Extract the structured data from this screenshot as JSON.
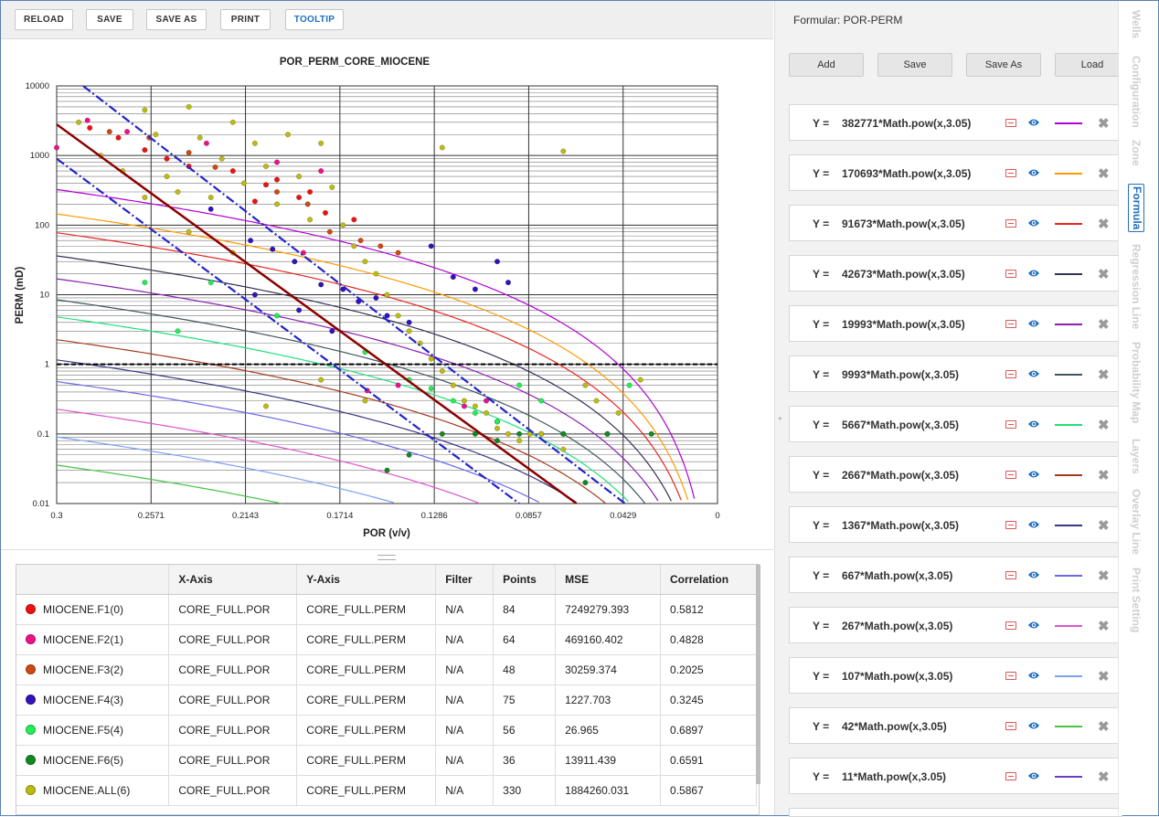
{
  "toolbar": {
    "reload": "RELOAD",
    "save": "SAVE",
    "save_as": "SAVE AS",
    "print": "PRINT",
    "tooltip": "TOOLTIP"
  },
  "chart_data": {
    "type": "scatter",
    "title": "POR_PERM_CORE_MIOCENE",
    "xlabel": "POR (v/v)",
    "ylabel": "PERM (mD)",
    "x_scale": "linear-reversed",
    "y_scale": "log",
    "xlim": [
      0.3,
      0
    ],
    "ylim": [
      0.01,
      10000
    ],
    "grid": true,
    "x_ticks": [
      "0.3",
      "0.2571",
      "0.2143",
      "0.1714",
      "0.1286",
      "0.0857",
      "0.0429",
      "0"
    ],
    "y_ticks": [
      "10000",
      "1000",
      "100",
      "10",
      "1",
      "0.1",
      "0.01"
    ],
    "cutoff_line": {
      "y": 1,
      "style": "dashed",
      "color": "#000000"
    },
    "regression_lines": [
      {
        "style": "solid",
        "color": "#8b0000",
        "points": [
          [
            0.3,
            2800
          ],
          [
            0.064,
            0.01
          ]
        ]
      },
      {
        "style": "dash-dot",
        "color": "#2222cc",
        "points": [
          [
            0.288,
            10000
          ],
          [
            0.042,
            0.01
          ]
        ]
      },
      {
        "style": "dash-dot",
        "color": "#2222cc",
        "points": [
          [
            0.3,
            900
          ],
          [
            0.09,
            0.01
          ]
        ]
      }
    ],
    "formula_curves": [
      {
        "coef": 382771,
        "color": "#b300d6"
      },
      {
        "coef": 170693,
        "color": "#ff9900"
      },
      {
        "coef": 91673,
        "color": "#e8251f"
      },
      {
        "coef": 42673,
        "color": "#333355"
      },
      {
        "coef": 19993,
        "color": "#8a1fb0"
      },
      {
        "coef": 9993,
        "color": "#40565c"
      },
      {
        "coef": 5667,
        "color": "#1fe07a"
      },
      {
        "coef": 2667,
        "color": "#a33b1d"
      },
      {
        "coef": 1367,
        "color": "#373785"
      },
      {
        "coef": 667,
        "color": "#6a6ae8"
      },
      {
        "coef": 267,
        "color": "#dd55cc"
      },
      {
        "coef": 107,
        "color": "#7aa3f5"
      },
      {
        "coef": 42,
        "color": "#47c447"
      },
      {
        "coef": 11,
        "color": "#6a3fc4"
      }
    ],
    "series": [
      {
        "name": "MIOCENE.F1(0)",
        "color": "#ee1111",
        "points": [
          [
            0.285,
            2500
          ],
          [
            0.272,
            1800
          ],
          [
            0.25,
            900
          ],
          [
            0.22,
            600
          ],
          [
            0.205,
            380
          ],
          [
            0.19,
            250
          ],
          [
            0.178,
            150
          ],
          [
            0.165,
            120
          ],
          [
            0.21,
            220
          ],
          [
            0.24,
            700
          ],
          [
            0.26,
            1200
          ],
          [
            0.2,
            450
          ],
          [
            0.185,
            300
          ]
        ]
      },
      {
        "name": "MIOCENE.F2(1)",
        "color": "#ee1189",
        "points": [
          [
            0.3,
            1300
          ],
          [
            0.286,
            3200
          ],
          [
            0.268,
            2200
          ],
          [
            0.232,
            1500
          ],
          [
            0.2,
            800
          ],
          [
            0.18,
            600
          ],
          [
            0.188,
            40
          ],
          [
            0.159,
            0.42
          ],
          [
            0.145,
            0.5
          ],
          [
            0.115,
            0.25
          ],
          [
            0.105,
            0.3
          ],
          [
            0.1,
            0.15
          ]
        ]
      },
      {
        "name": "MIOCENE.F3(2)",
        "color": "#cc4a11",
        "points": [
          [
            0.276,
            2200
          ],
          [
            0.258,
            1800
          ],
          [
            0.24,
            1100
          ],
          [
            0.228,
            680
          ],
          [
            0.2,
            300
          ],
          [
            0.186,
            200
          ],
          [
            0.176,
            80
          ],
          [
            0.162,
            60
          ],
          [
            0.153,
            50
          ],
          [
            0.145,
            40
          ]
        ]
      },
      {
        "name": "MIOCENE.F4(3)",
        "color": "#3311bb",
        "points": [
          [
            0.23,
            170
          ],
          [
            0.212,
            60
          ],
          [
            0.202,
            45
          ],
          [
            0.192,
            30
          ],
          [
            0.18,
            14
          ],
          [
            0.17,
            12
          ],
          [
            0.163,
            8
          ],
          [
            0.15,
            5
          ],
          [
            0.14,
            4
          ],
          [
            0.13,
            50
          ],
          [
            0.12,
            18
          ],
          [
            0.11,
            12
          ],
          [
            0.1,
            30
          ],
          [
            0.095,
            15
          ],
          [
            0.19,
            6
          ],
          [
            0.175,
            3
          ],
          [
            0.21,
            10
          ],
          [
            0.155,
            9
          ]
        ]
      },
      {
        "name": "MIOCENE.F5(4)",
        "color": "#22ee55",
        "points": [
          [
            0.26,
            15
          ],
          [
            0.245,
            3
          ],
          [
            0.23,
            15
          ],
          [
            0.2,
            5
          ],
          [
            0.16,
            1.5
          ],
          [
            0.14,
            0.6
          ],
          [
            0.13,
            0.45
          ],
          [
            0.12,
            0.3
          ],
          [
            0.11,
            0.2
          ],
          [
            0.1,
            0.15
          ],
          [
            0.09,
            0.5
          ],
          [
            0.08,
            0.3
          ],
          [
            0.07,
            0.1
          ],
          [
            0.05,
            0.1
          ],
          [
            0.04,
            0.5
          ]
        ]
      },
      {
        "name": "MIOCENE.F6(5)",
        "color": "#118822",
        "points": [
          [
            0.14,
            0.05
          ],
          [
            0.125,
            0.1
          ],
          [
            0.11,
            0.1
          ],
          [
            0.1,
            0.08
          ],
          [
            0.09,
            0.1
          ],
          [
            0.08,
            0.1
          ],
          [
            0.07,
            0.1
          ],
          [
            0.05,
            0.1
          ],
          [
            0.03,
            0.1
          ],
          [
            0.15,
            0.03
          ],
          [
            0.06,
            0.02
          ]
        ]
      },
      {
        "name": "MIOCENE.ALL(6)",
        "color": "#bbbb11",
        "points": [
          [
            0.29,
            3000
          ],
          [
            0.28,
            1000
          ],
          [
            0.27,
            600
          ],
          [
            0.26,
            4500
          ],
          [
            0.255,
            2000
          ],
          [
            0.25,
            500
          ],
          [
            0.245,
            300
          ],
          [
            0.24,
            5000
          ],
          [
            0.235,
            1800
          ],
          [
            0.23,
            250
          ],
          [
            0.225,
            900
          ],
          [
            0.22,
            3000
          ],
          [
            0.215,
            400
          ],
          [
            0.21,
            1500
          ],
          [
            0.205,
            700
          ],
          [
            0.2,
            200
          ],
          [
            0.195,
            2000
          ],
          [
            0.19,
            500
          ],
          [
            0.185,
            120
          ],
          [
            0.18,
            1500
          ],
          [
            0.175,
            350
          ],
          [
            0.17,
            100
          ],
          [
            0.165,
            50
          ],
          [
            0.16,
            30
          ],
          [
            0.155,
            20
          ],
          [
            0.15,
            10
          ],
          [
            0.145,
            5
          ],
          [
            0.14,
            3
          ],
          [
            0.135,
            2
          ],
          [
            0.13,
            1.2
          ],
          [
            0.125,
            0.8
          ],
          [
            0.12,
            0.5
          ],
          [
            0.115,
            0.3
          ],
          [
            0.11,
            0.25
          ],
          [
            0.105,
            0.2
          ],
          [
            0.1,
            0.12
          ],
          [
            0.095,
            0.1
          ],
          [
            0.09,
            0.08
          ],
          [
            0.085,
            0.1
          ],
          [
            0.08,
            0.1
          ],
          [
            0.07,
            0.06
          ],
          [
            0.06,
            0.5
          ],
          [
            0.055,
            0.3
          ],
          [
            0.045,
            0.2
          ],
          [
            0.035,
            0.6
          ],
          [
            0.125,
            1300
          ],
          [
            0.07,
            1150
          ],
          [
            0.205,
            0.25
          ],
          [
            0.18,
            0.6
          ],
          [
            0.16,
            0.3
          ],
          [
            0.26,
            250
          ],
          [
            0.24,
            80
          ],
          [
            0.22,
            40
          ]
        ]
      }
    ]
  },
  "table": {
    "headers": [
      "",
      "X-Axis",
      "Y-Axis",
      "Filter",
      "Points",
      "MSE",
      "Correlation"
    ],
    "rows": [
      {
        "color": "#ee1111",
        "name": "MIOCENE.F1(0)",
        "x": "CORE_FULL.POR",
        "y": "CORE_FULL.PERM",
        "filter": "N/A",
        "points": "84",
        "mse": "7249279.393",
        "corr": "0.5812"
      },
      {
        "color": "#ee1189",
        "name": "MIOCENE.F2(1)",
        "x": "CORE_FULL.POR",
        "y": "CORE_FULL.PERM",
        "filter": "N/A",
        "points": "64",
        "mse": "469160.402",
        "corr": "0.4828"
      },
      {
        "color": "#cc4a11",
        "name": "MIOCENE.F3(2)",
        "x": "CORE_FULL.POR",
        "y": "CORE_FULL.PERM",
        "filter": "N/A",
        "points": "48",
        "mse": "30259.374",
        "corr": "0.2025"
      },
      {
        "color": "#3311bb",
        "name": "MIOCENE.F4(3)",
        "x": "CORE_FULL.POR",
        "y": "CORE_FULL.PERM",
        "filter": "N/A",
        "points": "75",
        "mse": "1227.703",
        "corr": "0.3245"
      },
      {
        "color": "#22ee55",
        "name": "MIOCENE.F5(4)",
        "x": "CORE_FULL.POR",
        "y": "CORE_FULL.PERM",
        "filter": "N/A",
        "points": "56",
        "mse": "26.965",
        "corr": "0.6897"
      },
      {
        "color": "#118822",
        "name": "MIOCENE.F6(5)",
        "x": "CORE_FULL.POR",
        "y": "CORE_FULL.PERM",
        "filter": "N/A",
        "points": "36",
        "mse": "13911.439",
        "corr": "0.6591"
      },
      {
        "color": "#bbbb11",
        "name": "MIOCENE.ALL(6)",
        "x": "CORE_FULL.POR",
        "y": "CORE_FULL.PERM",
        "filter": "N/A",
        "points": "330",
        "mse": "1884260.031",
        "corr": "0.5867"
      }
    ]
  },
  "formula_panel": {
    "title": "Formular: POR-PERM",
    "buttons": [
      "Add",
      "Save",
      "Save As",
      "Load"
    ],
    "y_label": "Y =",
    "formulas": [
      {
        "text": "382771*Math.pow(x,3.05)",
        "color": "#b300d6"
      },
      {
        "text": "170693*Math.pow(x,3.05)",
        "color": "#ff9900"
      },
      {
        "text": "91673*Math.pow(x,3.05)",
        "color": "#e8251f"
      },
      {
        "text": "42673*Math.pow(x,3.05)",
        "color": "#333355"
      },
      {
        "text": "19993*Math.pow(x,3.05)",
        "color": "#8a1fb0"
      },
      {
        "text": "9993*Math.pow(x,3.05)",
        "color": "#40565c"
      },
      {
        "text": "5667*Math.pow(x,3.05)",
        "color": "#1fe07a"
      },
      {
        "text": "2667*Math.pow(x,3.05)",
        "color": "#a33b1d"
      },
      {
        "text": "1367*Math.pow(x,3.05)",
        "color": "#373785"
      },
      {
        "text": "667*Math.pow(x,3.05)",
        "color": "#6a6ae8"
      },
      {
        "text": "267*Math.pow(x,3.05)",
        "color": "#dd55cc"
      },
      {
        "text": "107*Math.pow(x,3.05)",
        "color": "#7aa3f5"
      },
      {
        "text": "42*Math.pow(x,3.05)",
        "color": "#47c447"
      },
      {
        "text": "11*Math.pow(x,3.05)",
        "color": "#6a3fc4"
      }
    ]
  },
  "side_tabs": {
    "items": [
      "Wells",
      "Configuration",
      "Zone",
      "Formula",
      "Regression Line",
      "Probability Map",
      "Layers",
      "Overlay Line",
      "Print Setting"
    ],
    "active": "Formula"
  }
}
